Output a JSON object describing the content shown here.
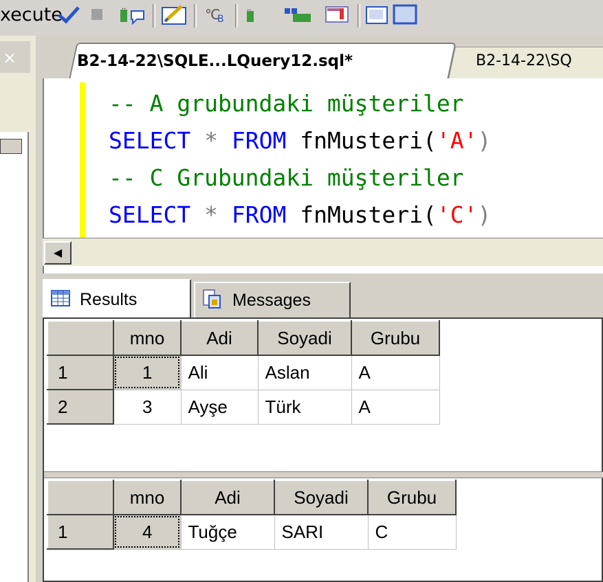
{
  "toolbar": {
    "execute_label": "xecute",
    "icons": [
      "checkmark-icon",
      "stop-icon",
      "display-plan-icon",
      "query-options-icon",
      "intellisense-icon",
      "include-plan-icon",
      "results-to-grid-icon",
      "results-to-file-icon",
      "comment-icon",
      "uncomment-icon"
    ]
  },
  "tabs": {
    "active_label": "B2-14-22\\SQLE...LQuery12.sql*",
    "inactive_label": "B2-14-22\\SQ"
  },
  "code": {
    "lines": [
      {
        "type": "comment",
        "text": "-- A grubundaki müşteriler"
      },
      {
        "type": "select",
        "kw1": "SELECT",
        "star": "*",
        "kw2": "FROM",
        "fn": "fnMusteri(",
        "arg": "'A'",
        "close": ")"
      },
      {
        "type": "comment",
        "text": "-- C Grubundaki müşteriler"
      },
      {
        "type": "select",
        "kw1": "SELECT",
        "star": "*",
        "kw2": "FROM",
        "fn": "fnMusteri(",
        "arg": "'C'",
        "close": ")"
      }
    ]
  },
  "results": {
    "tab_results": "Results",
    "tab_messages": "Messages",
    "grid1": {
      "columns": [
        "mno",
        "Adi",
        "Soyadi",
        "Grubu"
      ],
      "rows": [
        {
          "num": "1",
          "mno": "1",
          "adi": "Ali",
          "soyadi": "Aslan",
          "grubu": "A"
        },
        {
          "num": "2",
          "mno": "3",
          "adi": "Ayşe",
          "soyadi": "Türk",
          "grubu": "A"
        }
      ]
    },
    "grid2": {
      "columns": [
        "mno",
        "Adi",
        "Soyadi",
        "Grubu"
      ],
      "rows": [
        {
          "num": "1",
          "mno": "4",
          "adi": "Tuğçe",
          "soyadi": "SARI",
          "grubu": "C"
        }
      ]
    }
  }
}
